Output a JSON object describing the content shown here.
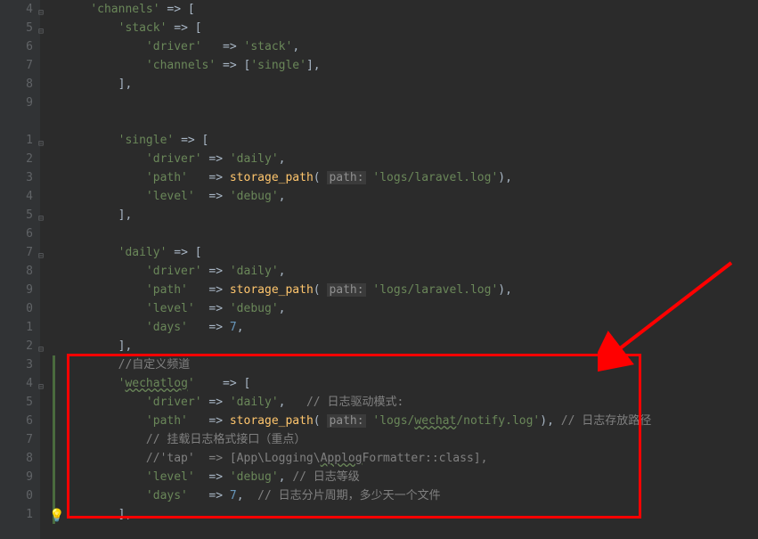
{
  "lines": [
    {
      "num": "4",
      "fold": true,
      "code": [
        {
          "t": "    "
        },
        {
          "t": "'channels'",
          "c": "s-string"
        },
        {
          "t": " => ["
        }
      ]
    },
    {
      "num": "5",
      "fold": true,
      "code": [
        {
          "t": "        "
        },
        {
          "t": "'stack'",
          "c": "s-string"
        },
        {
          "t": " => ["
        }
      ]
    },
    {
      "num": "6",
      "code": [
        {
          "t": "            "
        },
        {
          "t": "'driver'",
          "c": "s-string"
        },
        {
          "t": "   => "
        },
        {
          "t": "'stack'",
          "c": "s-string"
        },
        {
          "t": ","
        }
      ]
    },
    {
      "num": "7",
      "code": [
        {
          "t": "            "
        },
        {
          "t": "'channels'",
          "c": "s-string"
        },
        {
          "t": " => ["
        },
        {
          "t": "'single'",
          "c": "s-string"
        },
        {
          "t": "],"
        }
      ]
    },
    {
      "num": "8",
      "code": [
        {
          "t": "        ],"
        }
      ]
    },
    {
      "num": "9",
      "code": [
        {
          "t": ""
        }
      ]
    },
    {
      "num": " ",
      "code": [
        {
          "t": ""
        }
      ]
    },
    {
      "num": "1",
      "fold": true,
      "code": [
        {
          "t": "        "
        },
        {
          "t": "'single'",
          "c": "s-string"
        },
        {
          "t": " => ["
        }
      ]
    },
    {
      "num": "2",
      "code": [
        {
          "t": "            "
        },
        {
          "t": "'driver'",
          "c": "s-string"
        },
        {
          "t": " => "
        },
        {
          "t": "'daily'",
          "c": "s-string"
        },
        {
          "t": ","
        }
      ]
    },
    {
      "num": "3",
      "code": [
        {
          "t": "            "
        },
        {
          "t": "'path'",
          "c": "s-string"
        },
        {
          "t": "   => "
        },
        {
          "t": "storage_path",
          "c": "s-func"
        },
        {
          "t": "( "
        },
        {
          "t": "path:",
          "c": "s-param-bg"
        },
        {
          "t": " "
        },
        {
          "t": "'logs/laravel.log'",
          "c": "s-string"
        },
        {
          "t": "),"
        }
      ]
    },
    {
      "num": "4",
      "code": [
        {
          "t": "            "
        },
        {
          "t": "'level'",
          "c": "s-string"
        },
        {
          "t": "  => "
        },
        {
          "t": "'debug'",
          "c": "s-string"
        },
        {
          "t": ","
        }
      ]
    },
    {
      "num": "5",
      "fold": true,
      "code": [
        {
          "t": "        ],"
        }
      ]
    },
    {
      "num": "6",
      "code": [
        {
          "t": ""
        }
      ]
    },
    {
      "num": "7",
      "fold": true,
      "code": [
        {
          "t": "        "
        },
        {
          "t": "'daily'",
          "c": "s-string"
        },
        {
          "t": " => ["
        }
      ]
    },
    {
      "num": "8",
      "code": [
        {
          "t": "            "
        },
        {
          "t": "'driver'",
          "c": "s-string"
        },
        {
          "t": " => "
        },
        {
          "t": "'daily'",
          "c": "s-string"
        },
        {
          "t": ","
        }
      ]
    },
    {
      "num": "9",
      "code": [
        {
          "t": "            "
        },
        {
          "t": "'path'",
          "c": "s-string"
        },
        {
          "t": "   => "
        },
        {
          "t": "storage_path",
          "c": "s-func"
        },
        {
          "t": "( "
        },
        {
          "t": "path:",
          "c": "s-param-bg"
        },
        {
          "t": " "
        },
        {
          "t": "'logs/laravel.log'",
          "c": "s-string"
        },
        {
          "t": "),"
        }
      ]
    },
    {
      "num": "0",
      "code": [
        {
          "t": "            "
        },
        {
          "t": "'level'",
          "c": "s-string"
        },
        {
          "t": "  => "
        },
        {
          "t": "'debug'",
          "c": "s-string"
        },
        {
          "t": ","
        }
      ]
    },
    {
      "num": "1",
      "code": [
        {
          "t": "            "
        },
        {
          "t": "'days'",
          "c": "s-string"
        },
        {
          "t": "   => "
        },
        {
          "t": "7",
          "c": "s-number"
        },
        {
          "t": ","
        }
      ]
    },
    {
      "num": "2",
      "fold": true,
      "code": [
        {
          "t": "        ],"
        }
      ]
    },
    {
      "num": "3",
      "mod": true,
      "code": [
        {
          "t": "        "
        },
        {
          "t": "//自定义频道",
          "c": "s-comment"
        }
      ]
    },
    {
      "num": "4",
      "fold": true,
      "mod": true,
      "code": [
        {
          "t": "        "
        },
        {
          "t": "'",
          "c": "s-string"
        },
        {
          "t": "wechatlog",
          "c": "s-string s-under"
        },
        {
          "t": "'",
          "c": "s-string"
        },
        {
          "t": "    => ["
        }
      ]
    },
    {
      "num": "5",
      "mod": true,
      "code": [
        {
          "t": "            "
        },
        {
          "t": "'driver'",
          "c": "s-string"
        },
        {
          "t": " => "
        },
        {
          "t": "'daily'",
          "c": "s-string"
        },
        {
          "t": ",   "
        },
        {
          "t": "// 日志驱动模式:",
          "c": "s-comment"
        }
      ]
    },
    {
      "num": "6",
      "mod": true,
      "code": [
        {
          "t": "            "
        },
        {
          "t": "'path'",
          "c": "s-string"
        },
        {
          "t": "   => "
        },
        {
          "t": "storage_path",
          "c": "s-func"
        },
        {
          "t": "( "
        },
        {
          "t": "path:",
          "c": "s-param-bg"
        },
        {
          "t": " "
        },
        {
          "t": "'logs/",
          "c": "s-string"
        },
        {
          "t": "wechat",
          "c": "s-string s-under"
        },
        {
          "t": "/notify.log'",
          "c": "s-string"
        },
        {
          "t": "), "
        },
        {
          "t": "// 日志存放路径",
          "c": "s-comment"
        }
      ]
    },
    {
      "num": "7",
      "mod": true,
      "code": [
        {
          "t": "            "
        },
        {
          "t": "// 挂载日志格式接口（重点）",
          "c": "s-comment"
        }
      ]
    },
    {
      "num": "8",
      "mod": true,
      "code": [
        {
          "t": "            "
        },
        {
          "t": "//'tap'  => [App\\Logging\\",
          "c": "s-comment"
        },
        {
          "t": "Applog",
          "c": "s-comment s-under"
        },
        {
          "t": "Formatter::class],",
          "c": "s-comment"
        }
      ]
    },
    {
      "num": "9",
      "mod": true,
      "code": [
        {
          "t": "            "
        },
        {
          "t": "'level'",
          "c": "s-string"
        },
        {
          "t": "  => "
        },
        {
          "t": "'debug'",
          "c": "s-string"
        },
        {
          "t": ", "
        },
        {
          "t": "// 日志等级",
          "c": "s-comment"
        }
      ]
    },
    {
      "num": "0",
      "mod": true,
      "code": [
        {
          "t": "            "
        },
        {
          "t": "'days'",
          "c": "s-string"
        },
        {
          "t": "   => "
        },
        {
          "t": "7",
          "c": "s-number"
        },
        {
          "t": ",  "
        },
        {
          "t": "// 日志分片周期，多少天一个文件",
          "c": "s-comment"
        }
      ]
    },
    {
      "num": "1",
      "mod": true,
      "code": [
        {
          "t": "        ],"
        }
      ]
    }
  ]
}
